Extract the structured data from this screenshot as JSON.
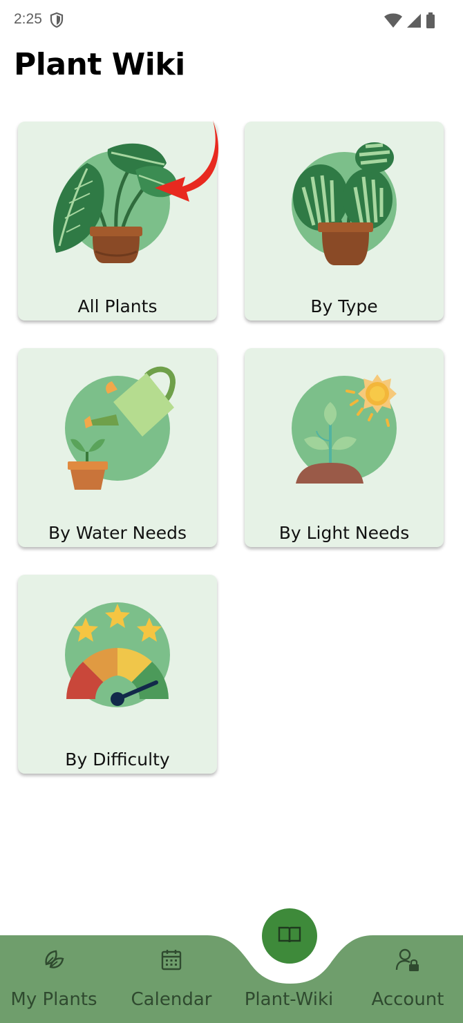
{
  "status_bar": {
    "time": "2:25"
  },
  "header": {
    "title": "Plant Wiki"
  },
  "categories": [
    {
      "label": "All Plants",
      "icon": "monstera-plant-icon"
    },
    {
      "label": "By Type",
      "icon": "potted-plant-icon"
    },
    {
      "label": "By Water Needs",
      "icon": "watering-can-icon"
    },
    {
      "label": "By Light Needs",
      "icon": "sun-sprout-icon"
    },
    {
      "label": "By Difficulty",
      "icon": "difficulty-gauge-icon"
    }
  ],
  "bottom_nav": {
    "items": [
      {
        "label": "My Plants",
        "icon": "leaf-icon"
      },
      {
        "label": "Calendar",
        "icon": "calendar-icon"
      },
      {
        "label": "Plant-Wiki",
        "icon": "book-icon",
        "active": true
      },
      {
        "label": "Account",
        "icon": "user-lock-icon"
      }
    ]
  },
  "colors": {
    "nav_background": "#6f9e6c",
    "active_button": "#3e8a3a",
    "card_background": "#e6f2e6",
    "illustration_circle": "#7cbf8a",
    "annotation_arrow": "#e8291f"
  }
}
